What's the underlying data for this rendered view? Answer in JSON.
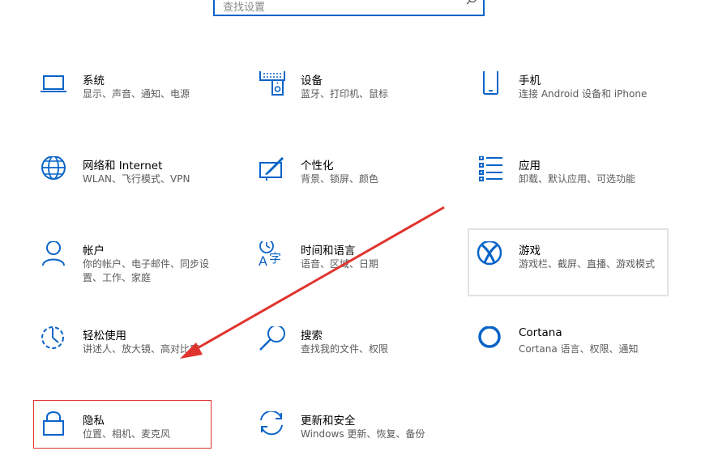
{
  "search": {
    "placeholder": "查找设置"
  },
  "tiles": [
    {
      "title": "系统",
      "desc": "显示、声音、通知、电源",
      "icon": "laptop-icon"
    },
    {
      "title": "设备",
      "desc": "蓝牙、打印机、鼠标",
      "icon": "keyboard-speaker-icon"
    },
    {
      "title": "手机",
      "desc": "连接 Android 设备和 iPhone",
      "icon": "phone-icon"
    },
    {
      "title": "网络和 Internet",
      "desc": "WLAN、飞行模式、VPN",
      "icon": "globe-icon"
    },
    {
      "title": "个性化",
      "desc": "背景、锁屏、颜色",
      "icon": "paint-icon"
    },
    {
      "title": "应用",
      "desc": "卸载、默认应用、可选功能",
      "icon": "apps-list-icon"
    },
    {
      "title": "帐户",
      "desc": "你的帐户、电子邮件、同步设置、工作、家庭",
      "icon": "person-icon"
    },
    {
      "title": "时间和语言",
      "desc": "语音、区域、日期",
      "icon": "time-language-icon"
    },
    {
      "title": "游戏",
      "desc": "游戏栏、截屏、直播、游戏模式",
      "icon": "xbox-icon"
    },
    {
      "title": "轻松使用",
      "desc": "讲述人、放大镜、高对比度",
      "icon": "ease-of-access-icon"
    },
    {
      "title": "搜索",
      "desc": "查找我的文件、权限",
      "icon": "search-icon"
    },
    {
      "title": "Cortana",
      "desc": "Cortana 语言、权限、通知",
      "icon": "cortana-icon"
    },
    {
      "title": "隐私",
      "desc": "位置、相机、麦克风",
      "icon": "lock-icon"
    },
    {
      "title": "更新和安全",
      "desc": "Windows 更新、恢复、备份",
      "icon": "sync-icon"
    }
  ],
  "colors": {
    "accent": "#0a64c8",
    "annotation": "#e0342e"
  }
}
